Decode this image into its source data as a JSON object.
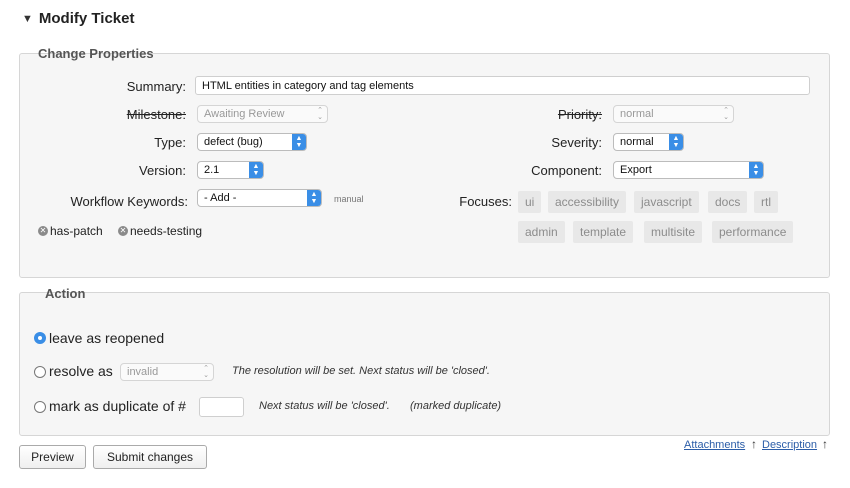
{
  "header": {
    "title": "Modify Ticket"
  },
  "properties": {
    "legend": "Change Properties",
    "summary_label": "Summary:",
    "summary_value": "HTML entities in category and tag elements",
    "milestone_label": "Milestone:",
    "milestone_value": "Awaiting Review",
    "priority_label": "Priority:",
    "priority_value": "normal",
    "type_label": "Type:",
    "type_value": "defect (bug)",
    "severity_label": "Severity:",
    "severity_value": "normal",
    "version_label": "Version:",
    "version_value": "2.1",
    "component_label": "Component:",
    "component_value": "Export",
    "workflow_label": "Workflow Keywords:",
    "workflow_value": "- Add -",
    "manual_note": "manual",
    "focuses_label": "Focuses:",
    "focuses_row1": [
      "ui",
      "accessibility",
      "javascript",
      "docs",
      "rtl"
    ],
    "focuses_row2": [
      "admin",
      "template",
      "multisite",
      "performance"
    ],
    "keywords": [
      "has-patch",
      "needs-testing"
    ]
  },
  "action": {
    "legend": "Action",
    "leave_label": "leave as reopened",
    "resolve_label": "resolve as",
    "resolve_value": "invalid",
    "resolve_note": "The resolution will be set. Next status will be 'closed'.",
    "duplicate_label": "mark as duplicate of #",
    "duplicate_note1": "Next status will be 'closed'.",
    "duplicate_note2": "(marked duplicate)"
  },
  "footer": {
    "preview_label": "Preview",
    "submit_label": "Submit changes",
    "attachments_link": "Attachments",
    "description_link": "Description",
    "up_arrow": "↑"
  },
  "colors": {
    "accent": "#3a8ee6"
  }
}
